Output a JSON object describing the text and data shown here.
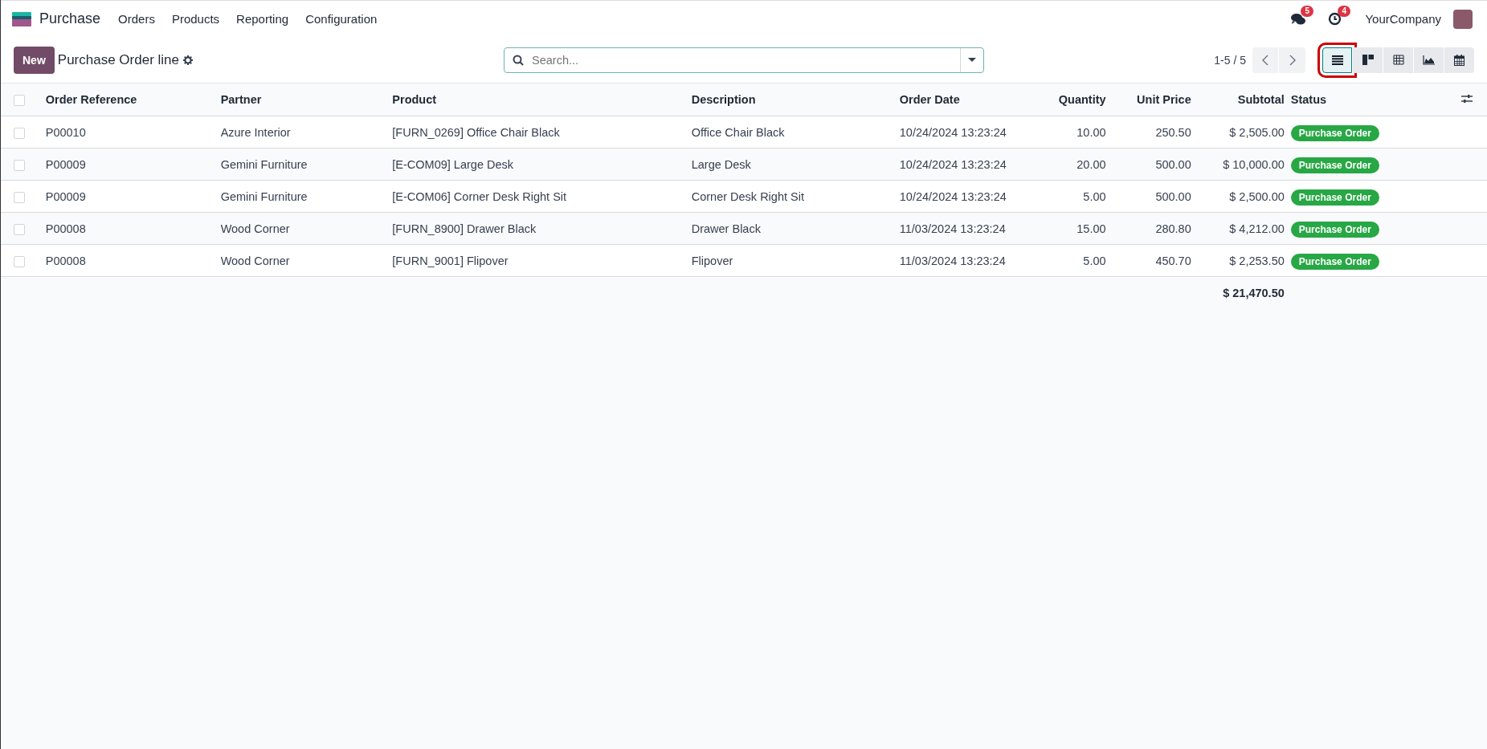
{
  "app": {
    "name": "Purchase"
  },
  "menu": [
    "Orders",
    "Products",
    "Reporting",
    "Configuration"
  ],
  "systray": {
    "messages_badge": "5",
    "activities_badge": "4",
    "company": "YourCompany"
  },
  "control_panel": {
    "new_button": "New",
    "breadcrumb": "Purchase Order line",
    "search": {
      "placeholder": "Search..."
    },
    "pager": "1-5 / 5",
    "views": [
      {
        "kind": "list",
        "selected": true,
        "highlighted": true
      },
      {
        "kind": "kanban",
        "selected": false,
        "highlighted": false
      },
      {
        "kind": "pivot",
        "selected": false,
        "highlighted": false
      },
      {
        "kind": "graph",
        "selected": false,
        "highlighted": false
      },
      {
        "kind": "calendar",
        "selected": false,
        "highlighted": false
      }
    ]
  },
  "table": {
    "all_selected": false,
    "columns": [
      "Order Reference",
      "Partner",
      "Product",
      "Description",
      "Order Date",
      "Quantity",
      "Unit Price",
      "Subtotal",
      "Status"
    ],
    "rows": [
      {
        "selected": false,
        "cells": [
          "P00010",
          "Azure Interior",
          "[FURN_0269] Office Chair Black",
          "Office Chair Black",
          "10/24/2024 13:23:24",
          "10.00",
          "250.50",
          "$ 2,505.00",
          "Purchase Order"
        ]
      },
      {
        "selected": false,
        "cells": [
          "P00009",
          "Gemini Furniture",
          "[E-COM09] Large Desk",
          "Large Desk",
          "10/24/2024 13:23:24",
          "20.00",
          "500.00",
          "$ 10,000.00",
          "Purchase Order"
        ]
      },
      {
        "selected": false,
        "cells": [
          "P00009",
          "Gemini Furniture",
          "[E-COM06] Corner Desk Right Sit",
          "Corner Desk Right Sit",
          "10/24/2024 13:23:24",
          "5.00",
          "500.00",
          "$ 2,500.00",
          "Purchase Order"
        ]
      },
      {
        "selected": false,
        "cells": [
          "P00008",
          "Wood Corner",
          "[FURN_8900] Drawer Black",
          "Drawer Black",
          "11/03/2024 13:23:24",
          "15.00",
          "280.80",
          "$ 4,212.00",
          "Purchase Order"
        ]
      },
      {
        "selected": false,
        "cells": [
          "P00008",
          "Wood Corner",
          "[FURN_9001] Flipover",
          "Flipover",
          "11/03/2024 13:23:24",
          "5.00",
          "450.70",
          "$ 2,253.50",
          "Purchase Order"
        ]
      }
    ],
    "total_subtotal": "$ 21,470.50"
  }
}
